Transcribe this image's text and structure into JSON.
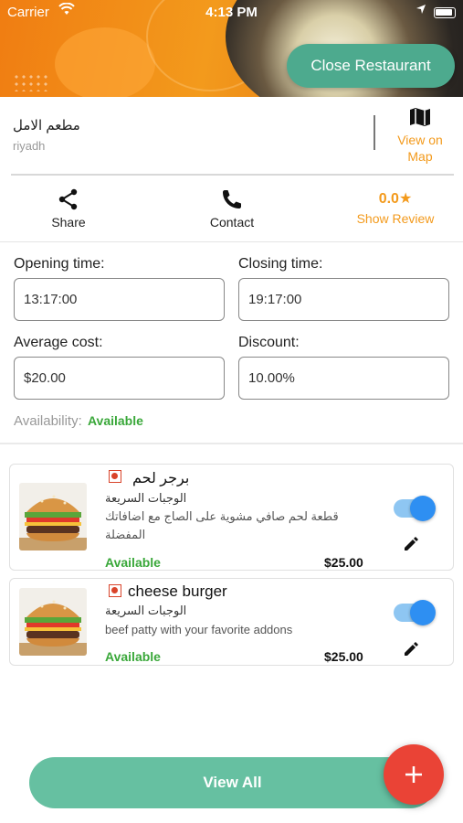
{
  "status_bar": {
    "carrier": "Carrier",
    "time": "4:13 PM"
  },
  "header": {
    "close_button": "Close Restaurant"
  },
  "restaurant": {
    "name": "مطعم الامل",
    "city": "riyadh",
    "view_on_map": "View on Map"
  },
  "actions": {
    "share": "Share",
    "contact": "Contact",
    "rating": "0.0",
    "show_review": "Show Review"
  },
  "form": {
    "opening_label": "Opening time:",
    "opening_value": "13:17:00",
    "closing_label": "Closing time:",
    "closing_value": "19:17:00",
    "avg_cost_label": "Average cost:",
    "avg_cost_value": "$20.00",
    "discount_label": "Discount:",
    "discount_value": "10.00%",
    "availability_label": "Availability:",
    "availability_value": "Available"
  },
  "menu_items": [
    {
      "title": "برجر لحم",
      "category": "الوجبات السريعة",
      "description": "قطعة لحم صافي مشوية على الصاج مع اضافاتك المفضلة",
      "status": "Available",
      "price": "$25.00",
      "enabled": true
    },
    {
      "title": "cheese burger",
      "category": "الوجبات السريعة",
      "description": "beef patty with your favorite addons",
      "status": "Available",
      "price": "$25.00",
      "enabled": true
    }
  ],
  "footer": {
    "view_all": "View All",
    "add_icon": "plus-icon"
  },
  "colors": {
    "orange": "#f39a1c",
    "green_button": "#4daa8e",
    "view_all": "#66c0a1",
    "fab": "#ea4336",
    "available": "#3aa83a",
    "toggle": "#2e8ff2"
  }
}
